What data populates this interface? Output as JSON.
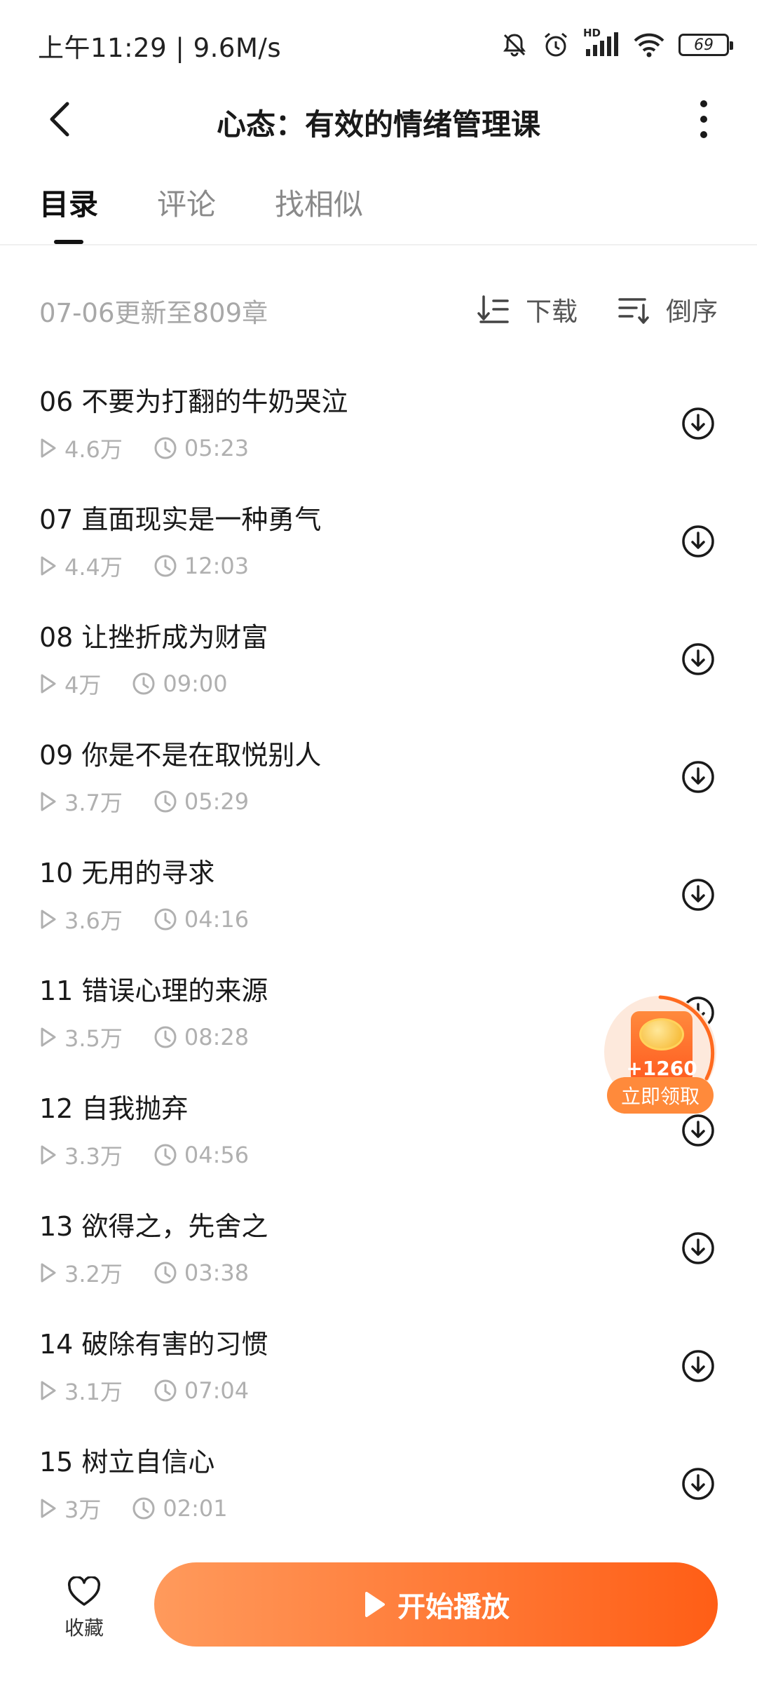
{
  "status_bar": {
    "time_speed": "上午11:29 | 9.6M/s",
    "hd_label": "HD",
    "battery_level": "69"
  },
  "header": {
    "title": "心态：有效的情绪管理课"
  },
  "tabs": [
    {
      "label": "目录",
      "active": true
    },
    {
      "label": "评论",
      "active": false
    },
    {
      "label": "找相似",
      "active": false
    }
  ],
  "update_bar": {
    "text": "07-06更新至809章",
    "download_label": "下载",
    "reverse_label": "倒序"
  },
  "chapters": [
    {
      "title": "06 不要为打翻的牛奶哭泣",
      "plays": "4.6万",
      "duration": "05:23"
    },
    {
      "title": "07 直面现实是一种勇气",
      "plays": "4.4万",
      "duration": "12:03"
    },
    {
      "title": "08 让挫折成为财富",
      "plays": "4万",
      "duration": "09:00"
    },
    {
      "title": "09 你是不是在取悦别人",
      "plays": "3.7万",
      "duration": "05:29"
    },
    {
      "title": "10 无用的寻求",
      "plays": "3.6万",
      "duration": "04:16"
    },
    {
      "title": "11 错误心理的来源",
      "plays": "3.5万",
      "duration": "08:28"
    },
    {
      "title": "12 自我抛弃",
      "plays": "3.3万",
      "duration": "04:56"
    },
    {
      "title": "13 欲得之，先舍之",
      "plays": "3.2万",
      "duration": "03:38"
    },
    {
      "title": "14 破除有害的习惯",
      "plays": "3.1万",
      "duration": "07:04"
    },
    {
      "title": "15 树立自信心",
      "plays": "3万",
      "duration": "02:01"
    }
  ],
  "reward": {
    "amount": "+1260",
    "button_label": "立即领取"
  },
  "bottom_bar": {
    "favorite_label": "收藏",
    "play_label": "开始播放"
  },
  "colors": {
    "accent": "#ff6a1f",
    "text_primary": "#1a1a1a",
    "text_secondary": "#b0b0b0"
  }
}
